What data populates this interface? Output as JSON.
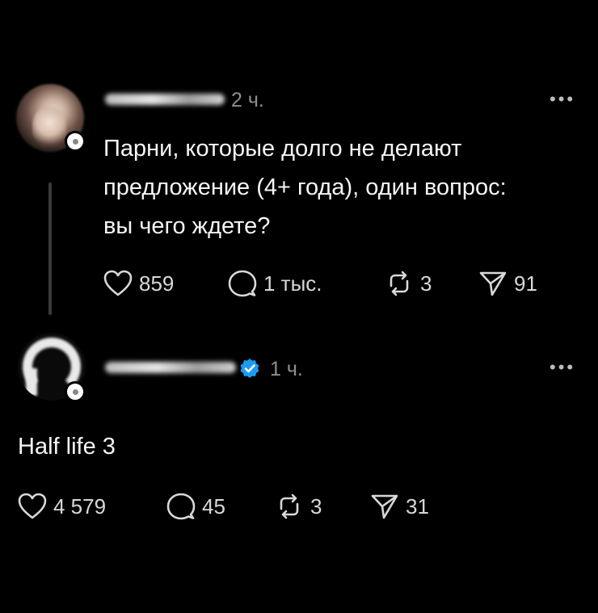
{
  "posts": [
    {
      "time": "2 ч.",
      "more": "•••",
      "text": "Парни, которые долго не делают\nпредложение (4+ года), один вопрос:\nвы чего ждете?",
      "likes": "859",
      "comments": "1 тыс.",
      "reposts": "3",
      "shares": "91"
    },
    {
      "time": "1 ч.",
      "verified": true,
      "more": "•••",
      "text": "Half life 3",
      "likes": "4 579",
      "comments": "45",
      "reposts": "3",
      "shares": "31"
    }
  ],
  "colors": {
    "background": "#000000",
    "text": "#f5f5f5",
    "muted": "#8f8f8f",
    "verified": "#1d9bf0"
  },
  "icons": {
    "like": "heart-icon",
    "comment": "comment-bubble-icon",
    "repost": "repost-icon",
    "share": "send-icon",
    "more": "more-dots-icon",
    "verified": "verified-badge-icon"
  }
}
